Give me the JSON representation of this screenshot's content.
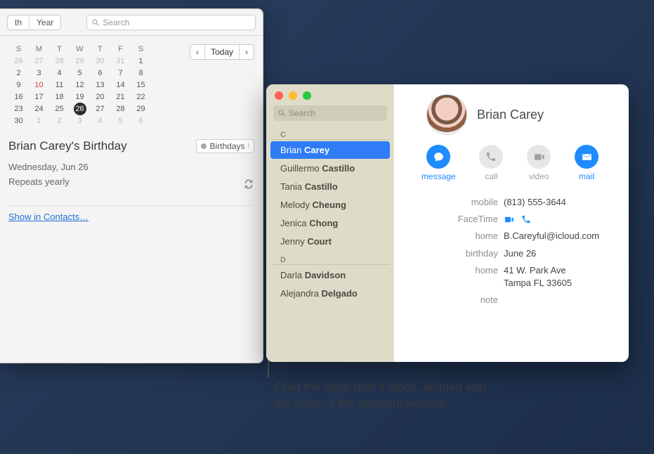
{
  "calendar": {
    "segments": {
      "th": "th",
      "year": "Year"
    },
    "search_placeholder": "Search",
    "nav": {
      "prev": "‹",
      "today": "Today",
      "next": "›"
    },
    "mini": {
      "dow": [
        "S",
        "M",
        "T",
        "W",
        "T",
        "F",
        "S"
      ],
      "weeks": [
        [
          {
            "d": "26",
            "o": true
          },
          {
            "d": "27",
            "o": true
          },
          {
            "d": "28",
            "o": true
          },
          {
            "d": "29",
            "o": true
          },
          {
            "d": "30",
            "o": true
          },
          {
            "d": "31",
            "o": true
          },
          {
            "d": "1"
          }
        ],
        [
          {
            "d": "2"
          },
          {
            "d": "3"
          },
          {
            "d": "4"
          },
          {
            "d": "5"
          },
          {
            "d": "6"
          },
          {
            "d": "7"
          },
          {
            "d": "8"
          }
        ],
        [
          {
            "d": "9"
          },
          {
            "d": "10",
            "red": true
          },
          {
            "d": "11"
          },
          {
            "d": "12"
          },
          {
            "d": "13"
          },
          {
            "d": "14"
          },
          {
            "d": "15"
          }
        ],
        [
          {
            "d": "16"
          },
          {
            "d": "17"
          },
          {
            "d": "18"
          },
          {
            "d": "19"
          },
          {
            "d": "20"
          },
          {
            "d": "21"
          },
          {
            "d": "22"
          }
        ],
        [
          {
            "d": "23"
          },
          {
            "d": "24"
          },
          {
            "d": "25"
          },
          {
            "d": "26",
            "today": true
          },
          {
            "d": "27"
          },
          {
            "d": "28"
          },
          {
            "d": "29"
          }
        ],
        [
          {
            "d": "30"
          },
          {
            "d": "1",
            "o": true
          },
          {
            "d": "2",
            "o": true
          },
          {
            "d": "3",
            "o": true
          },
          {
            "d": "4",
            "o": true
          },
          {
            "d": "5",
            "o": true
          },
          {
            "d": "6",
            "o": true
          }
        ]
      ]
    },
    "event": {
      "title": "Brian Carey's Birthday",
      "calendar_label": "Birthdays",
      "date": "Wednesday, Jun 26",
      "repeat": "Repeats yearly",
      "link": "Show in Contacts…"
    }
  },
  "contacts": {
    "search_placeholder": "Search",
    "sections": [
      {
        "letter": "C",
        "items": [
          {
            "first": "Brian",
            "last": "Carey",
            "sel": true
          },
          {
            "first": "Guillermo",
            "last": "Castillo"
          },
          {
            "first": "Tania",
            "last": "Castillo"
          },
          {
            "first": "Melody",
            "last": "Cheung"
          },
          {
            "first": "Jenica",
            "last": "Chong"
          },
          {
            "first": "Jenny",
            "last": "Court"
          }
        ]
      },
      {
        "letter": "D",
        "items": [
          {
            "first": "Darla",
            "last": "Davidson"
          },
          {
            "first": "Alejandra",
            "last": "Delgado"
          }
        ]
      }
    ],
    "card": {
      "name": "Brian Carey",
      "actions": {
        "message": "message",
        "call": "call",
        "video": "video",
        "mail": "mail"
      },
      "rows": [
        {
          "k": "mobile",
          "v": "(813) 555-3644"
        },
        {
          "k": "FaceTime",
          "ft": true
        },
        {
          "k": "home",
          "v": "B.Careyful@icloud.com"
        },
        {
          "k": "birthday",
          "v": "June 26"
        },
        {
          "k": "home",
          "v": "41 W. Park Ave\nTampa FL 33605"
        },
        {
          "k": "note",
          "v": ""
        }
      ]
    }
  },
  "caption": "Drag the edge until it stops, aligned with the edge of the adjacent window."
}
